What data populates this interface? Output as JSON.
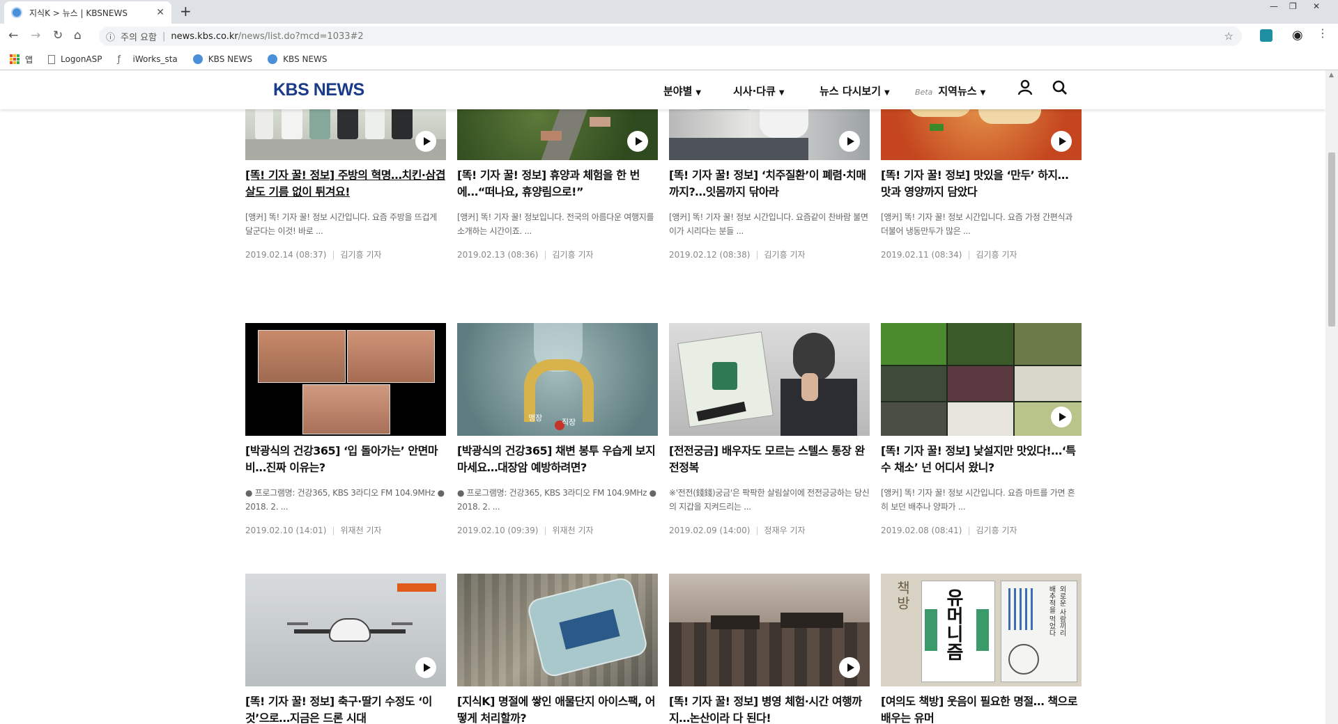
{
  "browser": {
    "tab_title": "지식K > 뉴스 | KBSNEWS",
    "url_warning": "주의 요함",
    "url_host": "news.kbs.co.kr",
    "url_path": "/news/list.do?mcd=1033#2",
    "bookmarks": [
      "앱",
      "LogonASP",
      "iWorks_sta",
      "KBS NEWS",
      "KBS NEWS"
    ]
  },
  "header": {
    "logo": "KBS NEWS",
    "menu": [
      {
        "label": "분야별"
      },
      {
        "label": "시사·다큐"
      },
      {
        "label": "뉴스 다시보기"
      },
      {
        "label": "지역뉴스",
        "badge": "Beta"
      }
    ]
  },
  "cards": [
    {
      "title": "[똑! 기자 꿀! 정보] 주방의 혁명…치킨·삼겹살도 기름 없이 튀겨요!",
      "summary": "[앵커] 똑! 기자 꿀! 정보 시간입니다. 요즘 주방을 뜨겁게 달군다는 이것! 바로 ...",
      "date": "2019.02.14 (08:37)",
      "reporter": "김기흥 기자",
      "underline": true
    },
    {
      "title": "[똑! 기자 꿀! 정보] 휴양과 체험을 한 번에…“떠나요, 휴양림으로!”",
      "summary": "[앵커] 똑! 기자 꿀! 정보입니다. 전국의 아름다운 여행지를 소개하는 시간이죠. ...",
      "date": "2019.02.13 (08:36)",
      "reporter": "김기흥 기자"
    },
    {
      "title": "[똑! 기자 꿀! 정보] ‘치주질환’이 폐렴·치매까지?…잇몸까지 닦아라",
      "summary": "[앵커] 똑! 기자 꿀! 정보 시간입니다. 요즘같이 찬바람 불면 이가 시리다는 분들 ...",
      "date": "2019.02.12 (08:38)",
      "reporter": "김기흥 기자"
    },
    {
      "title": "[똑! 기자 꿀! 정보] 맛있을 ‘만두’ 하지… 맛과 영양까지 담았다",
      "summary": "[앵커] 똑! 기자 꿀! 정보 시간입니다. 요즘 가정 간편식과 더불어 냉동만두가 많은 ...",
      "date": "2019.02.11 (08:34)",
      "reporter": "김기흥 기자"
    },
    {
      "title": "[박광식의 건강365] ‘입 돌아가는’ 안면마비…진짜 이유는?",
      "summary": "● 프로그램명: 건강365, KBS 3라디오 FM 104.9MHz ● 2018. 2. ...",
      "date": "2019.02.10 (14:01)",
      "reporter": "위재천 기자"
    },
    {
      "title": "[박광식의 건강365] 채변 봉투 우습게 보지 마세요…대장암 예방하려면?",
      "summary": "● 프로그램명: 건강365, KBS 3라디오 FM 104.9MHz ● 2018. 2. ...",
      "date": "2019.02.10 (09:39)",
      "reporter": "위재천 기자"
    },
    {
      "title": "[전전궁금] 배우자도 모르는 스텔스 통장 완전정복",
      "summary": "※'전전(錢錢)궁금'은 팍팍한 살림살이에 전전긍긍하는 당신의 지갑을 지켜드리는 ...",
      "date": "2019.02.09 (14:00)",
      "reporter": "정재우 기자"
    },
    {
      "title": "[똑! 기자 꿀! 정보] 낯설지만 맛있다!…‘특수 채소’ 넌 어디서 왔니?",
      "summary": "[앵커] 똑! 기자 꿀! 정보 시간입니다. 요즘 마트를 가면 흔히 보던 배추나 양파가 ...",
      "date": "2019.02.08 (08:41)",
      "reporter": "김기흥 기자"
    },
    {
      "title": "[똑! 기자 꿀! 정보] 축구·딸기 수정도 ‘이것’으로…지금은 드론 시대",
      "summary": "",
      "date": "",
      "reporter": ""
    },
    {
      "title": "[지식K] 명절에 쌓인 애물단지 아이스팩, 어떻게 처리할까?",
      "summary": "",
      "date": "",
      "reporter": ""
    },
    {
      "title": "[똑! 기자 꿀! 정보] 병영 체험·시간 여행까지…논산이라 다 된다!",
      "summary": "",
      "date": "",
      "reporter": ""
    },
    {
      "title": "[여의도 책방] 웃음이 필요한 명절… 책으로 배우는 유머",
      "summary": "",
      "date": "",
      "reporter": ""
    }
  ],
  "thumb_text": {
    "c5": [
      "직장",
      "맹장"
    ],
    "c12_left": "책방",
    "c12_book": "유머니즘",
    "c12_book2": "외로운 사람끼리 배추적을 먹었다"
  }
}
